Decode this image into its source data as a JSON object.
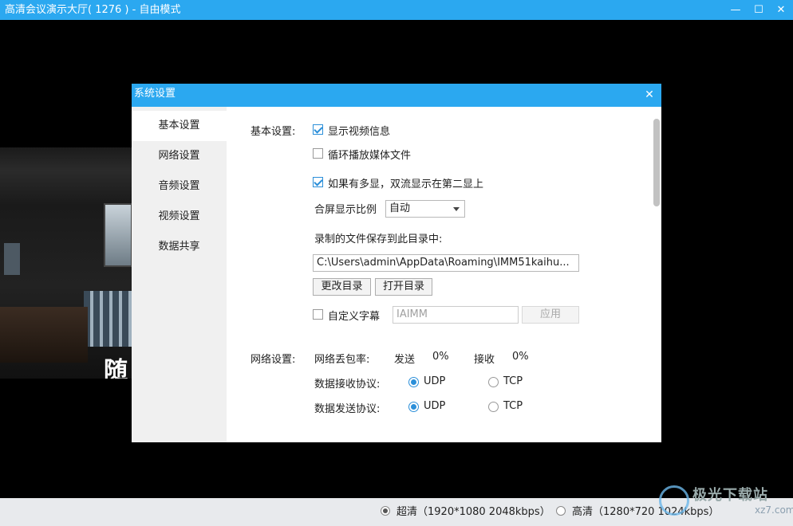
{
  "window": {
    "title": "高清会议演示大厅( 1276 ) - 自由模式",
    "minimize": "—",
    "maximize": "☐",
    "close": "✕"
  },
  "video": {
    "overlay_char": "随"
  },
  "statusbar": {
    "options": [
      {
        "label": "超清（1920*1080 2048kbps）",
        "selected": true
      },
      {
        "label": "高清（1280*720 1024kbps）",
        "selected": false
      }
    ]
  },
  "watermark": {
    "text": "极光下载站",
    "sub": "xz7.com"
  },
  "dialog": {
    "title": "系统设置",
    "close": "✕",
    "sidebar": {
      "items": [
        {
          "label": "基本设置",
          "active": true
        },
        {
          "label": "网络设置",
          "active": false
        },
        {
          "label": "音频设置",
          "active": false
        },
        {
          "label": "视频设置",
          "active": false
        },
        {
          "label": "数据共享",
          "active": false
        }
      ]
    },
    "basic": {
      "section_label": "基本设置:",
      "show_video_info": {
        "label": "显示视频信息",
        "checked": true
      },
      "loop_media": {
        "label": "循环播放媒体文件",
        "checked": false
      },
      "dual_display": {
        "label": "如果有多显，双流显示在第二显上",
        "checked": true
      },
      "aspect_label": "合屏显示比例",
      "aspect_value": "自动",
      "record_dir_label": "录制的文件保存到此目录中:",
      "record_dir_value": "C:\\Users\\admin\\AppData\\Roaming\\IMM51kaihu...",
      "change_dir": "更改目录",
      "open_dir": "打开目录",
      "custom_caption": {
        "label": "自定义字幕",
        "checked": false
      },
      "caption_value": "IAIMM",
      "apply": "应用"
    },
    "network": {
      "section_label": "网络设置:",
      "loss_label": "网络丢包率:",
      "send_label": "发送",
      "send_value": "0%",
      "recv_label": "接收",
      "recv_value": "0%",
      "recv_protocol_label": "数据接收协议:",
      "send_protocol_label": "数据发送协议:",
      "udp": "UDP",
      "tcp": "TCP",
      "recv_protocol": "UDP",
      "send_protocol": "UDP"
    }
  }
}
